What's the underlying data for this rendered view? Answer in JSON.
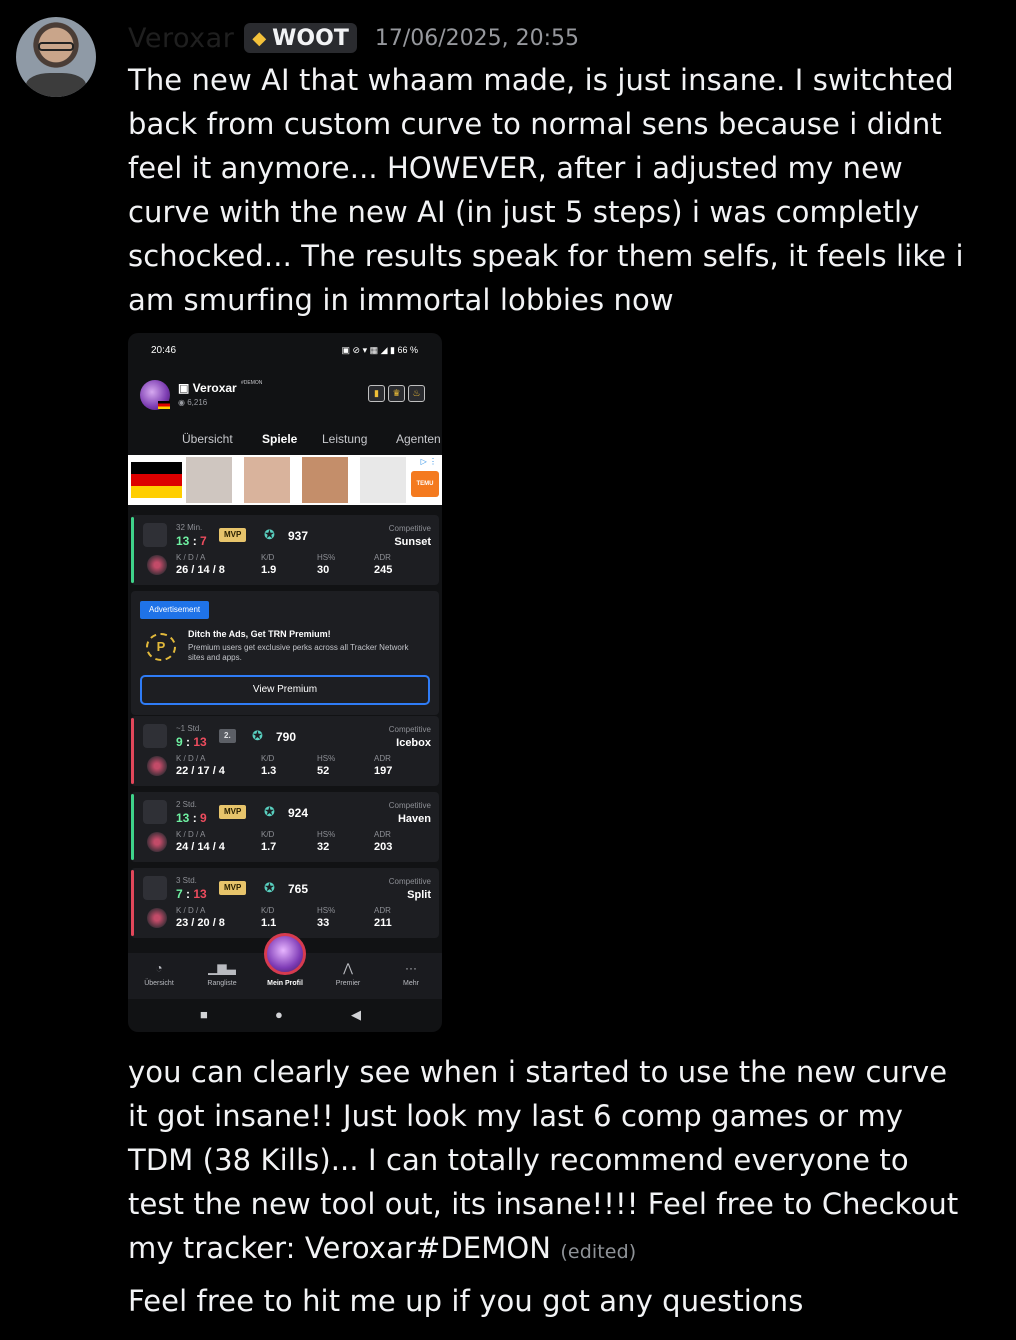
{
  "message": {
    "username": "Veroxar",
    "tag_badge": {
      "icon": "diamond-icon",
      "label": "WOOT"
    },
    "timestamp": "17/06/2025, 20:55",
    "paragraph_1": "The new AI that whaam made, is just insane. I switchted back from custom curve to normal sens because i didnt feel it anymore... HOWEVER, after i adjusted my new curve with the new AI (in just 5 steps) i was completly schocked... The results speak for them selfs, it feels like i am smurfing in immortal lobbies now",
    "paragraph_2": "you can clearly see when i started to use the new curve it got insane!! Just look my last 6 comp games or my TDM (38 Kills)... I can totally recommend everyone to test the new tool out, its insane!!!! Feel free to Checkout my tracker: Veroxar#DEMON",
    "edited_label": "(edited)",
    "paragraph_3": "Feel free to hit me up if you got any questions"
  },
  "phone": {
    "status_time": "20:46",
    "status_icons": "▣ ⊘ ▾ ▦ ◢ ▮ 66 %",
    "profile": {
      "name": "Veroxar",
      "tagline": "#DEMON",
      "views": "6,216",
      "badge_icons": [
        "medal-icon",
        "trophy-icon",
        "fire-icon"
      ]
    },
    "tabs": [
      "Übersicht",
      "Spiele",
      "Leistung",
      "Agenten"
    ],
    "active_tab": "Spiele",
    "ad_brand": "TEMU",
    "labels": {
      "kda": "K / D / A",
      "kd": "K/D",
      "hs": "HS%",
      "adr": "ADR"
    },
    "matches": [
      {
        "time": "32 Min.",
        "score_a": "13",
        "score_b": "7",
        "place": "MVP",
        "rr": "937",
        "mode": "Competitive",
        "map": "Sunset",
        "kda": "26 / 14 / 8",
        "kd": "1.9",
        "hs": "30",
        "adr": "245",
        "result": "win",
        "color": "#3fd38a"
      },
      {
        "time": "~1 Std.",
        "score_a": "9",
        "score_b": "13",
        "place": "2.",
        "rr": "790",
        "mode": "Competitive",
        "map": "Icebox",
        "kda": "22 / 17 / 4",
        "kd": "1.3",
        "hs": "52",
        "adr": "197",
        "result": "loss",
        "color": "#e2475a"
      },
      {
        "time": "2 Std.",
        "score_a": "13",
        "score_b": "9",
        "place": "MVP",
        "rr": "924",
        "mode": "Competitive",
        "map": "Haven",
        "kda": "24 / 14 / 4",
        "kd": "1.7",
        "hs": "32",
        "adr": "203",
        "result": "win",
        "color": "#3fd38a"
      },
      {
        "time": "3 Std.",
        "score_a": "7",
        "score_b": "13",
        "place": "MVP",
        "rr": "765",
        "mode": "Competitive",
        "map": "Split",
        "kda": "23 / 20 / 8",
        "kd": "1.1",
        "hs": "33",
        "adr": "211",
        "result": "loss",
        "color": "#e2475a"
      }
    ],
    "premium": {
      "tag": "Advertisement",
      "coin_letter": "P",
      "title": "Ditch the Ads, Get TRN Premium!",
      "description": "Premium users get exclusive perks across all Tracker Network sites and apps.",
      "button": "View Premium"
    },
    "bottom_nav": [
      {
        "label": "Übersicht",
        "icon": "gauge-icon"
      },
      {
        "label": "Rangliste",
        "icon": "leaderboard-icon"
      },
      {
        "label": "Mein Profil",
        "icon": "profile-icon"
      },
      {
        "label": "Premier",
        "icon": "premier-icon"
      },
      {
        "label": "Mehr",
        "icon": "more-icon"
      }
    ]
  }
}
